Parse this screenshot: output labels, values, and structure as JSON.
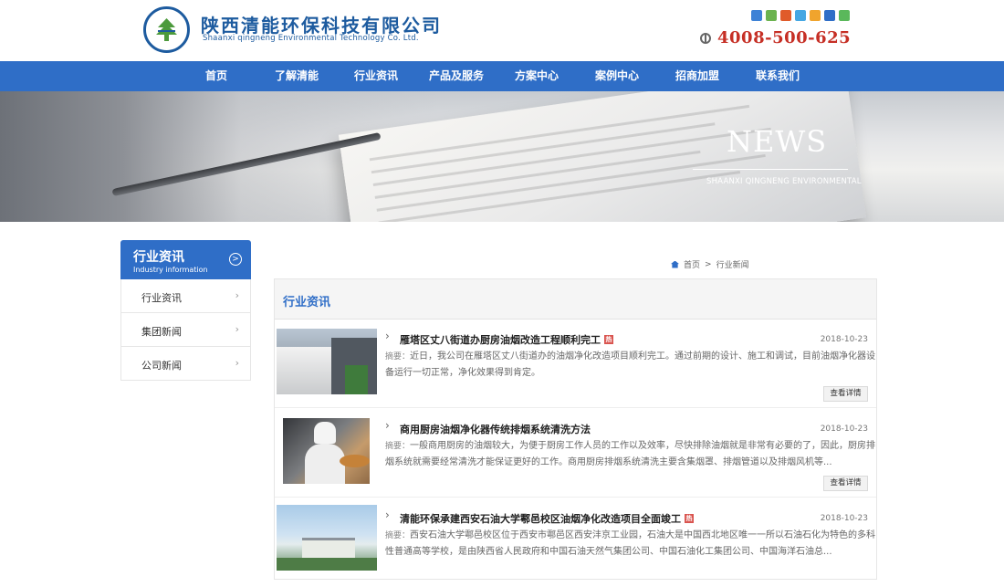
{
  "header": {
    "company_cn": "陕西清能环保科技有限公司",
    "company_en": "Shaanxi qingneng Environmental Technology Co. Ltd.",
    "hotline": "4008-500-625",
    "share_icons": [
      "#3e82d6",
      "#6bb34f",
      "#e05b2a",
      "#45a7e3",
      "#f0a42d",
      "#2f6ec7",
      "#5ab85b"
    ]
  },
  "nav": {
    "items": [
      "首页",
      "了解清能",
      "行业资讯",
      "产品及服务",
      "方案中心",
      "案例中心",
      "招商加盟",
      "联系我们"
    ]
  },
  "banner": {
    "title": "NEWS",
    "subtitle": "SHAANXI QINGNENG ENVIRONMENTAL"
  },
  "sidebar": {
    "title": "行业资讯",
    "subtitle": "Industry information",
    "items": [
      "行业资讯",
      "集团新闻",
      "公司新闻"
    ]
  },
  "breadcrumb": {
    "home": "首页",
    "sep": ">",
    "current": "行业新闻"
  },
  "section": {
    "title": "行业资讯"
  },
  "news": [
    {
      "title": "雁塔区丈八街道办厨房油烟改造工程顺利完工",
      "hot": "热",
      "date": "2018-10-23",
      "summary_label": "摘要：",
      "summary": "近日，我公司在雁塔区丈八街道办的油烟净化改造项目顺利完工。通过前期的设计、施工和调试，目前油烟净化器设备运行一切正常，净化效果得到肯定。",
      "more": "查看详情"
    },
    {
      "title": "商用厨房油烟净化器传统排烟系统清洗方法",
      "hot": "",
      "date": "2018-10-23",
      "summary_label": "摘要：",
      "summary": "一般商用厨房的油烟较大，为便于厨房工作人员的工作以及效率，尽快排除油烟就是非常有必要的了，因此，厨房排烟系统就需要经常清洗才能保证更好的工作。商用厨房排烟系统清洗主要含集烟罩、排烟管道以及排烟风机等...",
      "more": "查看详情"
    },
    {
      "title": "清能环保承建西安石油大学鄠邑校区油烟净化改造项目全面竣工",
      "hot": "热",
      "date": "2018-10-23",
      "summary_label": "摘要：",
      "summary": "西安石油大学鄠邑校区位于西安市鄠邑区西安沣京工业园，石油大是中国西北地区唯一一所以石油石化为特色的多科性普通高等学校，是由陕西省人民政府和中国石油天然气集团公司、中国石油化工集团公司、中国海洋石油总...",
      "more": ""
    }
  ]
}
